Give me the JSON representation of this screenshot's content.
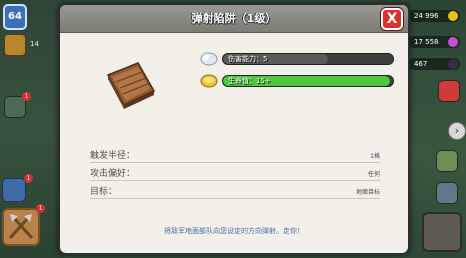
{
  "hud": {
    "player_level": "64",
    "shield_count": "14",
    "alert_count": "1",
    "resources": [
      {
        "value": "24 996",
        "icon": "gold-coin-icon",
        "color": "#e8c21d"
      },
      {
        "value": "17 558",
        "icon": "elixir-drop-icon",
        "color": "#c84fd0"
      },
      {
        "value": "467",
        "icon": "dark-elixir-icon",
        "color": "#3a2a45"
      }
    ]
  },
  "modal": {
    "title": "弹射陷阱（1级）",
    "close_label": "X",
    "stats": [
      {
        "label": "伤害能力：5",
        "icon": "cloud-icon",
        "color": "#5a5a5a",
        "fill_fraction": 0.62
      },
      {
        "label": "生命值：15+",
        "icon": "gold-icon",
        "color": "#4fc93c",
        "fill_fraction": 0.98
      }
    ],
    "info": [
      {
        "label": "触发半径：",
        "value": "1格"
      },
      {
        "label": "攻击偏好：",
        "value": "任何"
      },
      {
        "label": "目标：",
        "value": "地面目标"
      }
    ],
    "description": "将敌军地面部队向您设定的方向弹射。走你！"
  }
}
